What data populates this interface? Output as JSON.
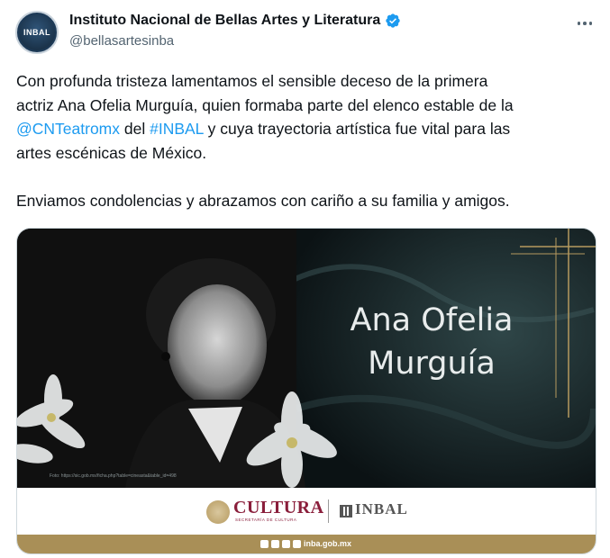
{
  "account": {
    "display_name": "Instituto Nacional de Bellas Artes y Literatura",
    "handle": "@bellasartesinba",
    "avatar_text": "INBAL",
    "verified": true
  },
  "tweet": {
    "line1": "Con profunda tristeza lamentamos el sensible deceso de la primera",
    "line2": "actriz Ana Ofelia Murguía, quien formaba parte del elenco estable de la",
    "mention": "@CNTeatromx",
    "mid_text": " del ",
    "hashtag": "#INBAL",
    "line3_rest": " y cuya trayectoria artística fue vital para las",
    "line4": "artes escénicas de México.",
    "line5": "Enviamos condolencias y abrazamos con cariño a su familia y amigos."
  },
  "media": {
    "name_line1": "Ana Ofelia",
    "name_line2": "Murguía",
    "photo_credit": "Foto: https://sic.gob.mx/ficha.php?table=cineasta&table_id=498",
    "logo_cultura": "CULTURA",
    "logo_cultura_sub": "SECRETARÍA DE CULTURA",
    "logo_inbal": "INBAL",
    "website": "inba.gob.mx"
  },
  "colors": {
    "link": "#1d9bf0",
    "verified": "#1d9bf0",
    "cultura": "#8a1e3b",
    "gold_bar": "#a98f57"
  },
  "icons": {
    "verified": "verified-badge-icon",
    "more": "more-options-icon"
  }
}
